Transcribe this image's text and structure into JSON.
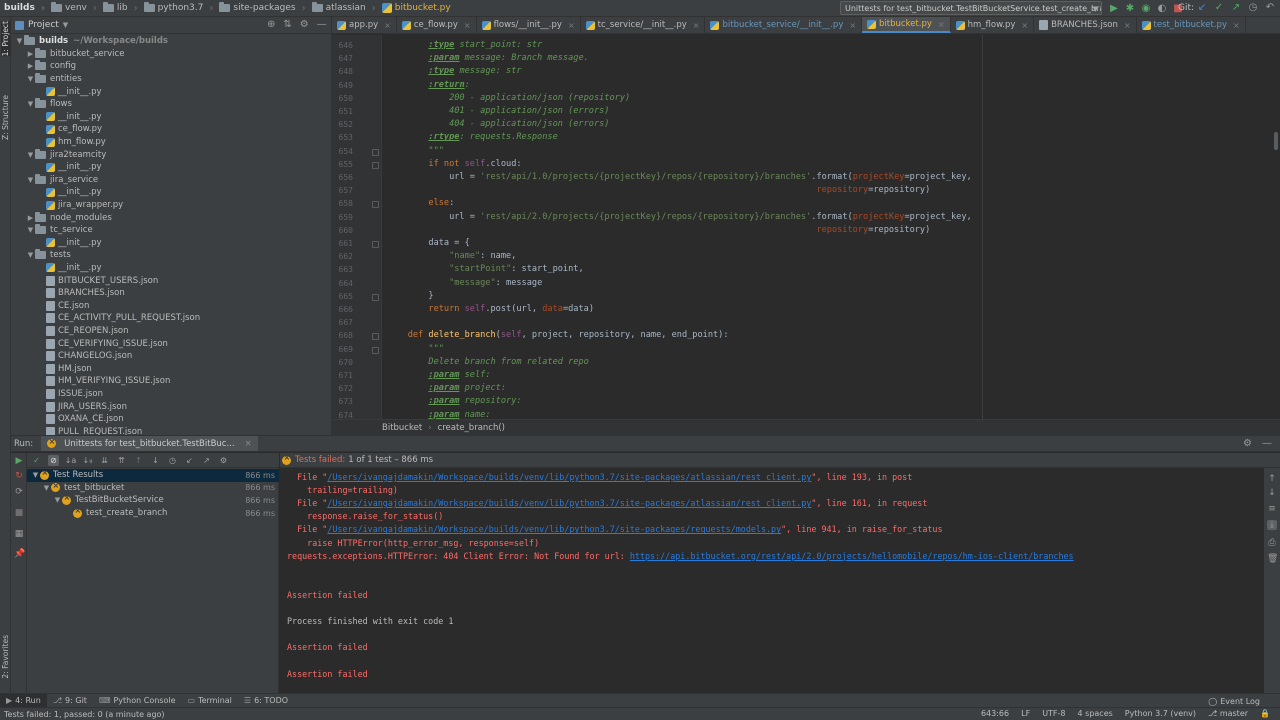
{
  "breadcrumbs": [
    "builds",
    "venv",
    "lib",
    "python3.7",
    "site-packages",
    "atlassian",
    "bitbucket.py"
  ],
  "run_config": "Unittests for test_bitbucket.TestBitBucketService.test_create_branch",
  "git_label": "Git:",
  "left_strip": {
    "project": "1: Project",
    "structure": "Z: Structure",
    "favorites": "2: Favorites"
  },
  "project_panel": {
    "title": "Project",
    "tree": [
      {
        "label": "builds",
        "extra": "~/Workspace/builds",
        "type": "folder",
        "depth": 0,
        "expanded": true,
        "bold": true
      },
      {
        "label": "bitbucket_service",
        "type": "folder",
        "depth": 1,
        "expanded": false
      },
      {
        "label": "config",
        "type": "folder",
        "depth": 1,
        "expanded": false
      },
      {
        "label": "entities",
        "type": "folder",
        "depth": 1,
        "expanded": true
      },
      {
        "label": "__init__.py",
        "type": "py",
        "depth": 2
      },
      {
        "label": "flows",
        "type": "folder",
        "depth": 1,
        "expanded": true
      },
      {
        "label": "__init__.py",
        "type": "py",
        "depth": 2
      },
      {
        "label": "ce_flow.py",
        "type": "py",
        "depth": 2
      },
      {
        "label": "hm_flow.py",
        "type": "py",
        "depth": 2
      },
      {
        "label": "jira2teamcity",
        "type": "folder",
        "depth": 1,
        "expanded": true
      },
      {
        "label": "__init__.py",
        "type": "py",
        "depth": 2
      },
      {
        "label": "jira_service",
        "type": "folder",
        "depth": 1,
        "expanded": true
      },
      {
        "label": "__init__.py",
        "type": "py",
        "depth": 2
      },
      {
        "label": "jira_wrapper.py",
        "type": "py",
        "depth": 2
      },
      {
        "label": "node_modules",
        "type": "folder",
        "depth": 1,
        "expanded": false
      },
      {
        "label": "tc_service",
        "type": "folder",
        "depth": 1,
        "expanded": true
      },
      {
        "label": "__init__.py",
        "type": "py",
        "depth": 2
      },
      {
        "label": "tests",
        "type": "folder",
        "depth": 1,
        "expanded": true
      },
      {
        "label": "__init__.py",
        "type": "py",
        "depth": 2
      },
      {
        "label": "BITBUCKET_USERS.json",
        "type": "json",
        "depth": 2
      },
      {
        "label": "BRANCHES.json",
        "type": "json",
        "depth": 2
      },
      {
        "label": "CE.json",
        "type": "json",
        "depth": 2
      },
      {
        "label": "CE_ACTIVITY_PULL_REQUEST.json",
        "type": "json",
        "depth": 2
      },
      {
        "label": "CE_REOPEN.json",
        "type": "json",
        "depth": 2
      },
      {
        "label": "CE_VERIFYING_ISSUE.json",
        "type": "json",
        "depth": 2
      },
      {
        "label": "CHANGELOG.json",
        "type": "json",
        "depth": 2
      },
      {
        "label": "HM.json",
        "type": "json",
        "depth": 2
      },
      {
        "label": "HM_VERIFYING_ISSUE.json",
        "type": "json",
        "depth": 2
      },
      {
        "label": "ISSUE.json",
        "type": "json",
        "depth": 2
      },
      {
        "label": "JIRA_USERS.json",
        "type": "json",
        "depth": 2
      },
      {
        "label": "OXANA_CE.json",
        "type": "json",
        "depth": 2
      },
      {
        "label": "PULL_REQUEST.json",
        "type": "json",
        "depth": 2
      }
    ]
  },
  "tabs": [
    {
      "label": "app.py",
      "style": "normal"
    },
    {
      "label": "ce_flow.py",
      "style": "normal"
    },
    {
      "label": "flows/__init__.py",
      "style": "normal"
    },
    {
      "label": "tc_service/__init__.py",
      "style": "normal"
    },
    {
      "label": "bitbucket_service/__init__.py",
      "style": "blue"
    },
    {
      "label": "bitbucket.py",
      "style": "active"
    },
    {
      "label": "hm_flow.py",
      "style": "normal"
    },
    {
      "label": "BRANCHES.json",
      "style": "json"
    },
    {
      "label": "test_bitbucket.py",
      "style": "blue"
    }
  ],
  "code_lines": [
    {
      "n": "646",
      "segs": [
        [
          "        ",
          ""
        ],
        [
          ":type",
          "doct"
        ],
        [
          " start_point: str",
          "doc"
        ]
      ]
    },
    {
      "n": "647",
      "segs": [
        [
          "        ",
          ""
        ],
        [
          ":param",
          "doct"
        ],
        [
          " message: Branch message.",
          "doc"
        ]
      ]
    },
    {
      "n": "648",
      "segs": [
        [
          "        ",
          ""
        ],
        [
          ":type",
          "doct"
        ],
        [
          " message: str",
          "doc"
        ]
      ]
    },
    {
      "n": "649",
      "segs": [
        [
          "        ",
          ""
        ],
        [
          ":return",
          "doct"
        ],
        [
          ":",
          "doc"
        ]
      ]
    },
    {
      "n": "650",
      "segs": [
        [
          "            200 - application/json (repository)",
          "doc"
        ]
      ]
    },
    {
      "n": "651",
      "segs": [
        [
          "            401 - application/json (errors)",
          "doc"
        ]
      ]
    },
    {
      "n": "652",
      "segs": [
        [
          "            404 - application/json (errors)",
          "doc"
        ]
      ]
    },
    {
      "n": "653",
      "segs": [
        [
          "        ",
          ""
        ],
        [
          ":rtype",
          "doct"
        ],
        [
          ": requests.Response",
          "doc"
        ]
      ]
    },
    {
      "n": "654",
      "segs": [
        [
          "        \"\"\"",
          "doc"
        ]
      ]
    },
    {
      "n": "655",
      "segs": [
        [
          "        ",
          ""
        ],
        [
          "if not ",
          "kw"
        ],
        [
          "self",
          "self"
        ],
        [
          ".cloud:",
          ""
        ]
      ]
    },
    {
      "n": "656",
      "segs": [
        [
          "            url = ",
          ""
        ],
        [
          "'rest/api/1.0/projects/{projectKey}/repos/{repository}/branches'",
          "str"
        ],
        [
          ".format(",
          ""
        ],
        [
          "projectKey",
          "par"
        ],
        [
          "=project_key,",
          ""
        ]
      ]
    },
    {
      "n": "657",
      "segs": [
        [
          "                                                                                   ",
          ""
        ],
        [
          "repository",
          "par"
        ],
        [
          "=repository)",
          ""
        ]
      ]
    },
    {
      "n": "658",
      "segs": [
        [
          "        ",
          ""
        ],
        [
          "else",
          "kw"
        ],
        [
          ":",
          ""
        ]
      ]
    },
    {
      "n": "659",
      "segs": [
        [
          "            url = ",
          ""
        ],
        [
          "'rest/api/2.0/projects/{projectKey}/repos/{repository}/branches'",
          "str"
        ],
        [
          ".format(",
          ""
        ],
        [
          "projectKey",
          "par"
        ],
        [
          "=project_key,",
          ""
        ]
      ]
    },
    {
      "n": "660",
      "segs": [
        [
          "                                                                                   ",
          ""
        ],
        [
          "repository",
          "par"
        ],
        [
          "=repository)",
          ""
        ]
      ]
    },
    {
      "n": "661",
      "segs": [
        [
          "        data = {",
          ""
        ]
      ]
    },
    {
      "n": "662",
      "segs": [
        [
          "            ",
          ""
        ],
        [
          "\"name\"",
          "str"
        ],
        [
          ": name,",
          ""
        ]
      ]
    },
    {
      "n": "663",
      "segs": [
        [
          "            ",
          ""
        ],
        [
          "\"startPoint\"",
          "str"
        ],
        [
          ": start_point,",
          ""
        ]
      ]
    },
    {
      "n": "664",
      "segs": [
        [
          "            ",
          ""
        ],
        [
          "\"message\"",
          "str"
        ],
        [
          ": message",
          ""
        ]
      ]
    },
    {
      "n": "665",
      "segs": [
        [
          "        }",
          ""
        ]
      ]
    },
    {
      "n": "666",
      "segs": [
        [
          "        ",
          ""
        ],
        [
          "return ",
          "kw"
        ],
        [
          "self",
          "self"
        ],
        [
          ".post(url, ",
          ""
        ],
        [
          "data",
          "par"
        ],
        [
          "=data)",
          ""
        ]
      ]
    },
    {
      "n": "667",
      "segs": [
        [
          "",
          ""
        ]
      ]
    },
    {
      "n": "668",
      "segs": [
        [
          "    ",
          ""
        ],
        [
          "def ",
          "kw"
        ],
        [
          "delete_branch",
          "fn"
        ],
        [
          "(",
          ""
        ],
        [
          "self",
          "self"
        ],
        [
          ", project, repository, name, end_point):",
          ""
        ]
      ]
    },
    {
      "n": "669",
      "segs": [
        [
          "        \"\"\"",
          "doc"
        ]
      ]
    },
    {
      "n": "670",
      "segs": [
        [
          "        Delete branch from related repo",
          "doc"
        ]
      ]
    },
    {
      "n": "671",
      "segs": [
        [
          "        ",
          ""
        ],
        [
          ":param",
          "doct"
        ],
        [
          " self:",
          "doc"
        ]
      ]
    },
    {
      "n": "672",
      "segs": [
        [
          "        ",
          ""
        ],
        [
          ":param",
          "doct"
        ],
        [
          " project:",
          "doc"
        ]
      ]
    },
    {
      "n": "673",
      "segs": [
        [
          "        ",
          ""
        ],
        [
          ":param",
          "doct"
        ],
        [
          " repository:",
          "doc"
        ]
      ]
    },
    {
      "n": "674",
      "segs": [
        [
          "        ",
          ""
        ],
        [
          ":param",
          "doct"
        ],
        [
          " name:",
          "doc"
        ]
      ]
    }
  ],
  "editor_crumb": [
    "Bitbucket",
    "create_branch()"
  ],
  "run_panel": {
    "title": "Run:",
    "tab": "Unittests for test_bitbucket.TestBitBuc...",
    "status_prefix": "Tests failed:",
    "status_detail": "1 of 1 test – 866 ms",
    "tree": [
      {
        "label": "Test Results",
        "depth": 0,
        "dur": "866 ms",
        "sel": true
      },
      {
        "label": "test_bitbucket",
        "depth": 1,
        "dur": "866 ms"
      },
      {
        "label": "TestBitBucketService",
        "depth": 2,
        "dur": "866 ms"
      },
      {
        "label": "test_create_branch",
        "depth": 3,
        "dur": "866 ms"
      }
    ],
    "console": [
      {
        "segs": [
          [
            "  File \"",
            "cred"
          ],
          [
            "/Users/ivangajdamakin/Workspace/builds/venv/lib/python3.7/site-packages/atlassian/rest_client.py",
            "clink"
          ],
          [
            "\", line 193, in post",
            "cred"
          ]
        ]
      },
      {
        "segs": [
          [
            "    trailing=trailing)",
            "cred"
          ]
        ]
      },
      {
        "segs": [
          [
            "  File \"",
            "cred"
          ],
          [
            "/Users/ivangajdamakin/Workspace/builds/venv/lib/python3.7/site-packages/atlassian/rest_client.py",
            "clink"
          ],
          [
            "\", line 161, in request",
            "cred"
          ]
        ]
      },
      {
        "segs": [
          [
            "    response.raise_for_status()",
            "cred"
          ]
        ]
      },
      {
        "segs": [
          [
            "  File \"",
            "cred"
          ],
          [
            "/Users/ivangajdamakin/Workspace/builds/venv/lib/python3.7/site-packages/requests/models.py",
            "clink"
          ],
          [
            "\", line 941, in raise_for_status",
            "cred"
          ]
        ]
      },
      {
        "segs": [
          [
            "    raise HTTPError(http_error_msg, response=self)",
            "cred"
          ]
        ]
      },
      {
        "segs": [
          [
            "requests.exceptions.HTTPError: 404 Client Error: Not Found for url: ",
            "cred"
          ],
          [
            "https://api.bitbucket.org/rest/api/2.0/projects/hellomobile/repos/hm-ios-client/branches",
            "clink"
          ]
        ]
      },
      {
        "segs": [
          [
            "",
            ""
          ]
        ]
      },
      {
        "segs": [
          [
            "",
            ""
          ]
        ]
      },
      {
        "segs": [
          [
            "Assertion failed",
            "cred"
          ]
        ]
      },
      {
        "segs": [
          [
            "",
            ""
          ]
        ]
      },
      {
        "segs": [
          [
            "Process finished with exit code 1",
            "cwhite"
          ]
        ]
      },
      {
        "segs": [
          [
            "",
            ""
          ]
        ]
      },
      {
        "segs": [
          [
            "Assertion failed",
            "cred"
          ]
        ]
      },
      {
        "segs": [
          [
            "",
            ""
          ]
        ]
      },
      {
        "segs": [
          [
            "Assertion failed",
            "cred"
          ]
        ]
      }
    ]
  },
  "bottom_tools": [
    {
      "label": "4: Run",
      "icon": "▶",
      "active": true
    },
    {
      "label": "9: Git",
      "icon": "⎇"
    },
    {
      "label": "Python Console",
      "icon": "⌨"
    },
    {
      "label": "Terminal",
      "icon": "▭"
    },
    {
      "label": "6: TODO",
      "icon": "☰"
    }
  ],
  "event_log": "Event Log",
  "status": {
    "message": "Tests failed: 1, passed: 0 (a minute ago)",
    "position": "643:66",
    "line_sep": "LF",
    "encoding": "UTF-8",
    "indent": "4 spaces",
    "interpreter": "Python 3.7 (venv)",
    "branch": "master"
  }
}
